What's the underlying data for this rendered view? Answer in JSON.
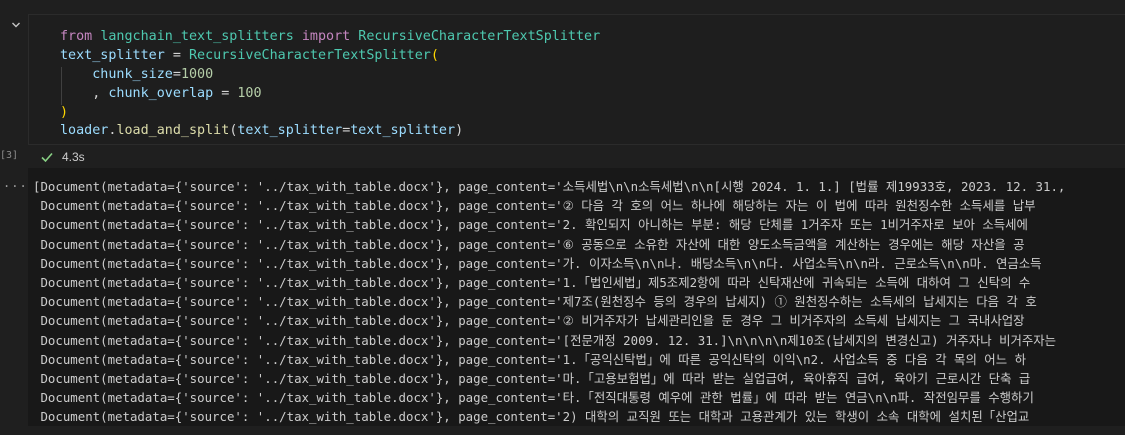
{
  "cell": {
    "execution_count": "[3]",
    "output_more_glyph": "...",
    "status": {
      "icon": "check-icon",
      "duration": "4.3s",
      "color": "#89d185"
    },
    "code": [
      [
        {
          "t": "from",
          "c": "kw"
        },
        {
          "t": " ",
          "c": "op"
        },
        {
          "t": "langchain_text_splitters",
          "c": "mod"
        },
        {
          "t": " ",
          "c": "op"
        },
        {
          "t": "import",
          "c": "kw"
        },
        {
          "t": " ",
          "c": "op"
        },
        {
          "t": "RecursiveCharacterTextSplitter",
          "c": "cls"
        }
      ],
      [
        {
          "t": "text_splitter",
          "c": "var"
        },
        {
          "t": " = ",
          "c": "op"
        },
        {
          "t": "RecursiveCharacterTextSplitter",
          "c": "cls"
        },
        {
          "t": "(",
          "c": "par"
        }
      ],
      [
        {
          "t": "    ",
          "c": "op"
        },
        {
          "t": "chunk_size",
          "c": "var"
        },
        {
          "t": "=",
          "c": "op"
        },
        {
          "t": "1000",
          "c": "num"
        }
      ],
      [
        {
          "t": "    , ",
          "c": "op"
        },
        {
          "t": "chunk_overlap",
          "c": "var"
        },
        {
          "t": " = ",
          "c": "op"
        },
        {
          "t": "100",
          "c": "num"
        }
      ],
      [
        {
          "t": ")",
          "c": "par"
        }
      ],
      [
        {
          "t": "loader",
          "c": "var"
        },
        {
          "t": ".",
          "c": "pun"
        },
        {
          "t": "load_and_split",
          "c": "fn"
        },
        {
          "t": "(",
          "c": "pun"
        },
        {
          "t": "text_splitter",
          "c": "var"
        },
        {
          "t": "=",
          "c": "op"
        },
        {
          "t": "text_splitter",
          "c": "var"
        },
        {
          "t": ")",
          "c": "pun"
        }
      ]
    ],
    "output": [
      "[Document(metadata={'source': '../tax_with_table.docx'}, page_content='소득세법\\n\\n소득세법\\n\\n[시행 2024. 1. 1.] [법률 제19933호, 2023. 12. 31.,",
      " Document(metadata={'source': '../tax_with_table.docx'}, page_content='② 다음 각 호의 어느 하나에 해당하는 자는 이 법에 따라 원천징수한 소득세를 납부",
      " Document(metadata={'source': '../tax_with_table.docx'}, page_content='2. 확인되지 아니하는 부분: 해당 단체를 1거주자 또는 1비거주자로 보아 소득세에",
      " Document(metadata={'source': '../tax_with_table.docx'}, page_content='⑥ 공동으로 소유한 자산에 대한 양도소득금액을 계산하는 경우에는 해당 자산을 공",
      " Document(metadata={'source': '../tax_with_table.docx'}, page_content='가. 이자소득\\n\\n나. 배당소득\\n\\n다. 사업소득\\n\\n라. 근로소득\\n\\n마. 연금소득",
      " Document(metadata={'source': '../tax_with_table.docx'}, page_content='1.「법인세법」제5조제2항에 따라 신탁재산에 귀속되는 소득에 대하여 그 신탁의 수",
      " Document(metadata={'source': '../tax_with_table.docx'}, page_content='제7조(원천징수 등의 경우의 납세지) ① 원천징수하는 소득세의 납세지는 다음 각 호",
      " Document(metadata={'source': '../tax_with_table.docx'}, page_content='② 비거주자가 납세관리인을 둔 경우 그 비거주자의 소득세 납세지는 그 국내사업장",
      " Document(metadata={'source': '../tax_with_table.docx'}, page_content='[전문개정 2009. 12. 31.]\\n\\n\\n\\n제10조(납세지의 변경신고) 거주자나 비거주자는",
      " Document(metadata={'source': '../tax_with_table.docx'}, page_content='1.「공익신탁법」에 따른 공익신탁의 이익\\n2. 사업소득 중 다음 각 목의 어느 하",
      " Document(metadata={'source': '../tax_with_table.docx'}, page_content='마.「고용보험법」에 따라 받는 실업급여, 육아휴직 급여, 육아기 근로시간 단축 급",
      " Document(metadata={'source': '../tax_with_table.docx'}, page_content='타.「전직대통령 예우에 관한 법률」에 따라 받는 연금\\n\\n파. 작전임무를 수행하기",
      " Document(metadata={'source': '../tax_with_table.docx'}, page_content='2) 대학의 교직원 또는 대학과 고용관계가 있는 학생이 소속 대학에 설치된「산업교"
    ]
  }
}
